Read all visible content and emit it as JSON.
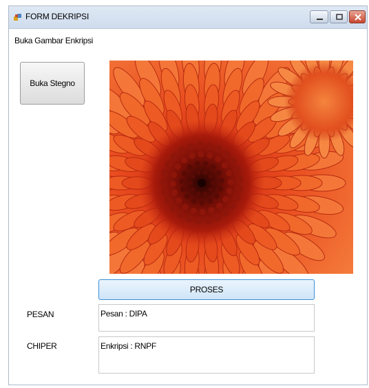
{
  "window": {
    "title": "FORM DEKRIPSI"
  },
  "form": {
    "open_image_label": "Buka Gambar Enkripsi",
    "open_stegno_button": "Buka Stegno",
    "process_button": "PROSES",
    "message_label": "PESAN",
    "message_value": "Pesan : DIPA",
    "cipher_label": "CHIPER",
    "cipher_value": "Enkripsi : RNPF"
  },
  "picture": {
    "description_icon": "flower-image"
  },
  "colors": {
    "titlebar": "#d6e2f1",
    "close_button": "#c8452f",
    "process_border": "#3b8fd6",
    "flower_center": "#5a0a05",
    "flower_petal": "#f2602a"
  }
}
